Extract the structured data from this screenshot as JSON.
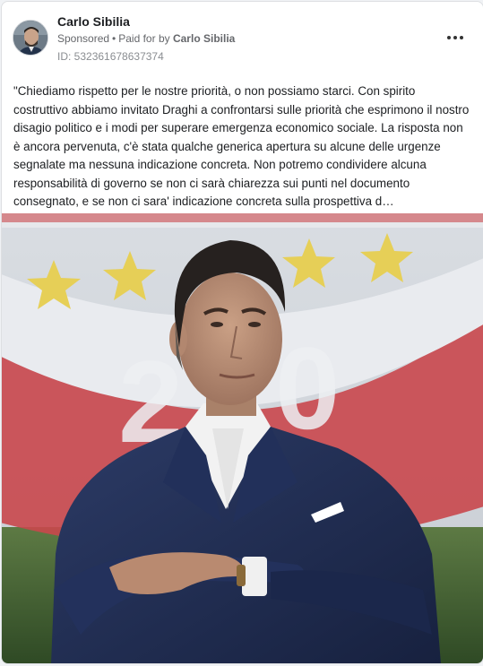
{
  "post": {
    "author": "Carlo Sibilia",
    "sponsored_label": "Sponsored",
    "dot": "•",
    "paid_prefix": "Paid for by",
    "paid_by": "Carlo Sibilia",
    "id_label": "ID: 532361678637374",
    "more_icon": "more-options-icon",
    "body": "\"Chiediamo rispetto per le nostre priorità, o non possiamo starci. Con spirito costruttivo abbiamo invitato Draghi a confrontarsi sulle priorità che esprimono il nostro disagio politico e i modi per superare emergenza economico sociale. La risposta non è ancora pervenuta, c'è stata qualche generica apertura su alcune delle urgenze segnalate ma nessuna indicazione concreta. Non potremo condividere alcuna responsabilità di governo se non ci sarà chiarezza sui punti nel documento consegnato, e se non ci sara' indicazione concreta sulla prospettiva d…"
  },
  "colors": {
    "background": "#f0f2f5",
    "card": "#ffffff",
    "secondary_text": "#65676b"
  }
}
